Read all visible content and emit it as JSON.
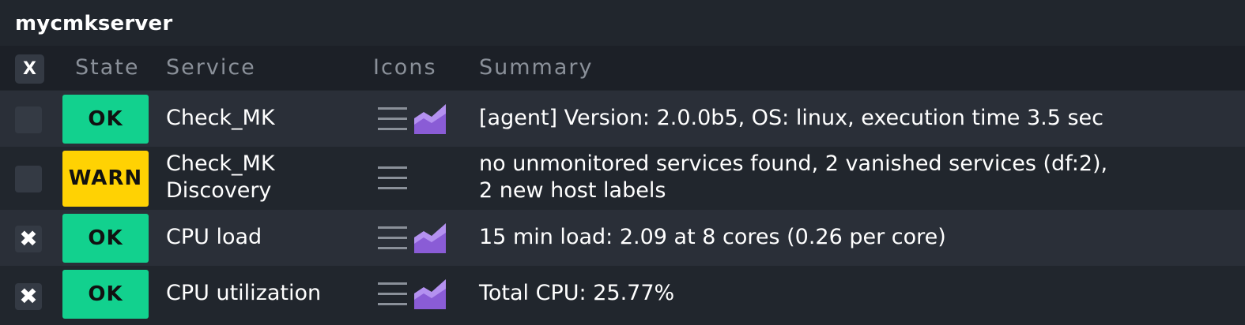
{
  "host": {
    "name": "mycmkserver"
  },
  "header": {
    "toggle_label": "X",
    "columns": {
      "state": "State",
      "service": "Service",
      "icons": "Icons",
      "summary": "Summary"
    }
  },
  "colors": {
    "ok": "#12d18e",
    "warn": "#ffd203",
    "graph": "#9b6fe0"
  },
  "rows": [
    {
      "checked": false,
      "checkbox_mark": "",
      "state": "OK",
      "service_line1": "Check_MK",
      "service_line2": "",
      "icons": [
        "menu-icon",
        "graph-icon"
      ],
      "summary_line1": "[agent] Version: 2.0.0b5, OS: linux, execution time 3.5 sec",
      "summary_line2": ""
    },
    {
      "checked": false,
      "checkbox_mark": "",
      "state": "WARN",
      "service_line1": "Check_MK",
      "service_line2": "Discovery",
      "icons": [
        "menu-icon"
      ],
      "summary_line1": "no unmonitored services found, 2 vanished services (df:2),",
      "summary_line2": "2 new host labels"
    },
    {
      "checked": true,
      "checkbox_mark": "✖",
      "state": "OK",
      "service_line1": "CPU load",
      "service_line2": "",
      "icons": [
        "menu-icon",
        "graph-icon"
      ],
      "summary_line1": "15 min load: 2.09 at 8 cores (0.26 per core)",
      "summary_line2": ""
    },
    {
      "checked": true,
      "checkbox_mark": "✖",
      "state": "OK",
      "service_line1": "CPU utilization",
      "service_line2": "",
      "icons": [
        "menu-icon",
        "graph-icon"
      ],
      "summary_line1": "Total CPU: 25.77%",
      "summary_line2": ""
    }
  ]
}
